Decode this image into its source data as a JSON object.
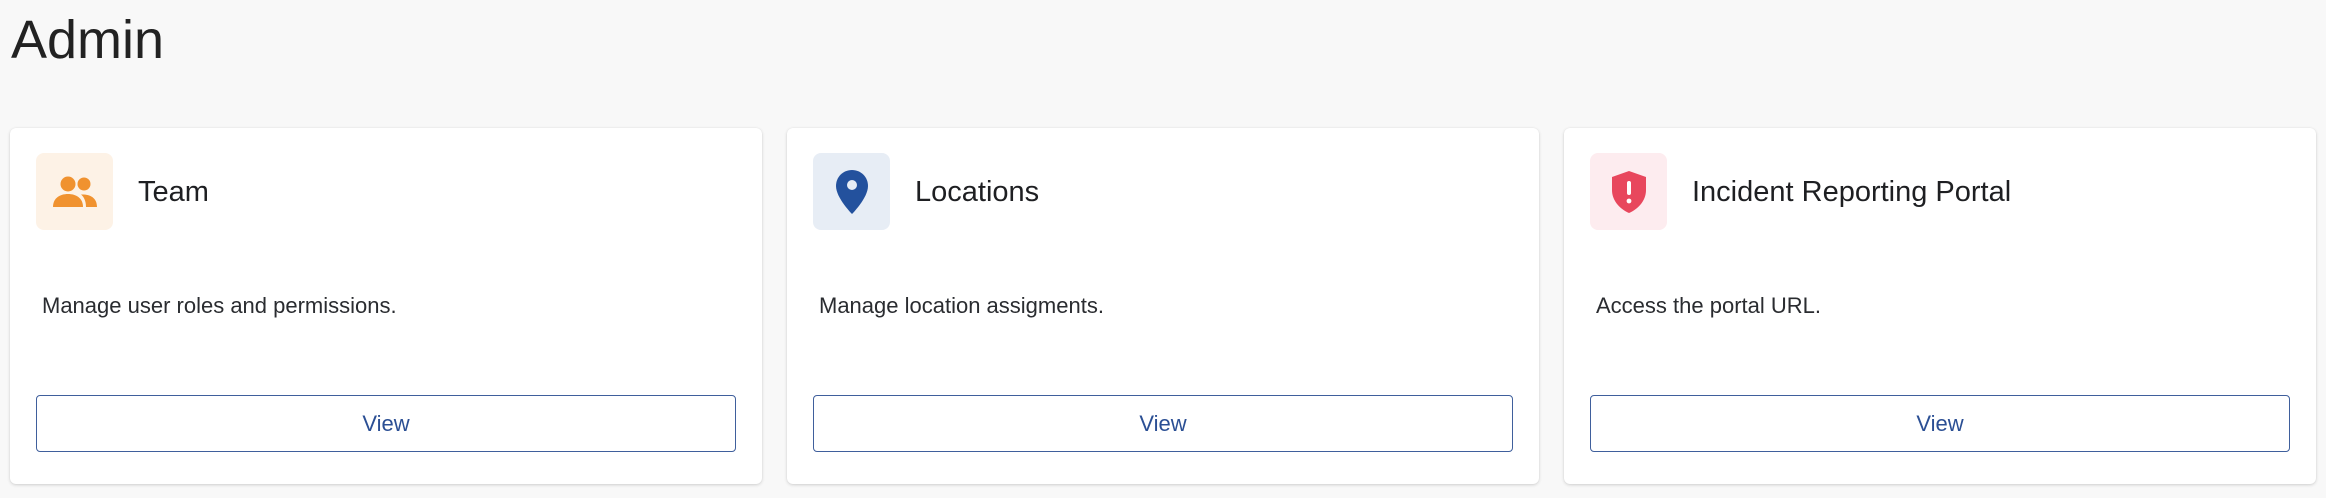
{
  "page": {
    "title": "Admin"
  },
  "cards": [
    {
      "title": "Team",
      "description": "Manage user roles and permissions.",
      "button_label": "View",
      "icon": "team-people-icon",
      "icon_color": "#f0922f",
      "icon_bg": "#fdf2e6"
    },
    {
      "title": "Locations",
      "description": "Manage location assigments.",
      "button_label": "View",
      "icon": "location-pin-icon",
      "icon_color": "#23519d",
      "icon_bg": "#e7edf5"
    },
    {
      "title": "Incident Reporting Portal",
      "description": "Access the portal URL.",
      "button_label": "View",
      "icon": "shield-alert-icon",
      "icon_color": "#e8475d",
      "icon_bg": "#fdecef"
    }
  ],
  "colors": {
    "page_bg": "#f8f8f8",
    "card_bg": "#ffffff",
    "button_border": "#3f5f9c",
    "button_text": "#2b4f94"
  }
}
